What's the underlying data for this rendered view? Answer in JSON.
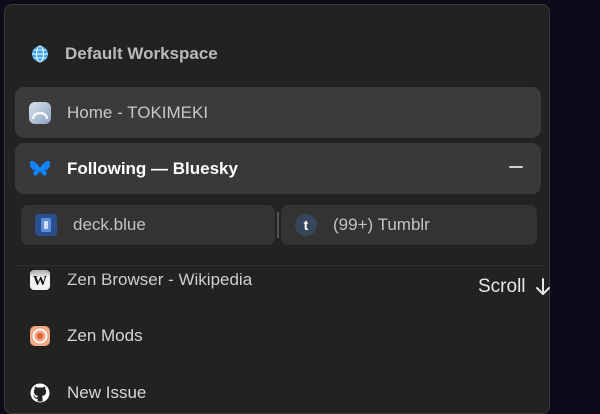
{
  "workspace": {
    "title": "Default Workspace",
    "icon": "globe-icon"
  },
  "tabs": [
    {
      "label": "Home - TOKIMEKI",
      "icon": "tokimeki-icon",
      "active": false
    },
    {
      "label": "Following — Bluesky",
      "icon": "bluesky-butterfly-icon",
      "active": true,
      "close": "minus-icon"
    }
  ],
  "split_view": [
    {
      "label": "deck.blue",
      "icon": "deckblue-icon"
    },
    {
      "label": "(99+) Tumblr",
      "icon": "tumblr-icon"
    }
  ],
  "list": [
    {
      "label": "Zen Browser - Wikipedia",
      "icon": "wikipedia-icon"
    },
    {
      "label": "Zen Mods",
      "icon": "zen-mods-icon"
    },
    {
      "label": "New Issue",
      "icon": "github-icon"
    }
  ],
  "overlay": {
    "scroll_label": "Scroll",
    "scroll_icon": "arrow-down-icon"
  },
  "colors": {
    "bluesky": "#1185fe",
    "tumblr": "#36465d",
    "panel": "#222222",
    "active_tab": "#393939"
  }
}
